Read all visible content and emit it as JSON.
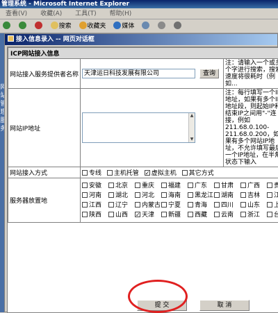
{
  "window": {
    "title": "管理系统 - Microsoft Internet Explorer",
    "menu": [
      "查看(V)",
      "收藏(A)",
      "工具(T)",
      "帮助(H)"
    ],
    "toolbar": [
      "搜索",
      "收藏夹",
      "媒体"
    ],
    "side_text": [
      "网",
      "站",
      "管",
      "理",
      "服",
      "务"
    ]
  },
  "dialog": {
    "title": "接入信息录入 -- 网页对话框",
    "section_title": "ICP网站接入信息",
    "provider": {
      "label": "网站接入服务提供者名称",
      "value": "天津运日科技发展有限公司",
      "search_button": "查询",
      "note": "注：请输入一个或多个字进行搜索，搜索速度将很耗时（例如..."
    },
    "ip": {
      "label": "网站IP地址",
      "note": "注：每行填写一个IP地址，如果有多个IP地址段，则起始IP和结束IP之间用\"-\"连接，例如211.68.0.100-211.68.0.200，如果有多个网站IP地址，不允许填写最后一个IP地址，在半角状态下输入"
    },
    "access": {
      "label": "网站接入方式",
      "options": [
        {
          "label": "专线",
          "checked": false
        },
        {
          "label": "主机托管",
          "checked": false
        },
        {
          "label": "虚拟主机",
          "checked": true
        },
        {
          "label": "其它方式",
          "checked": false
        }
      ]
    },
    "location": {
      "label": "服务器放置地",
      "provinces": [
        {
          "label": "安徽",
          "checked": false
        },
        {
          "label": "北京",
          "checked": false
        },
        {
          "label": "重庆",
          "checked": false
        },
        {
          "label": "福建",
          "checked": false
        },
        {
          "label": "广东",
          "checked": false
        },
        {
          "label": "甘肃",
          "checked": false
        },
        {
          "label": "广西",
          "checked": false
        },
        {
          "label": "贵州",
          "checked": false
        },
        {
          "label": "河南",
          "checked": false
        },
        {
          "label": "湖北",
          "checked": false
        },
        {
          "label": "河北",
          "checked": false
        },
        {
          "label": "海南",
          "checked": false
        },
        {
          "label": "黑龙江",
          "checked": false
        },
        {
          "label": "湖南",
          "checked": false
        },
        {
          "label": "吉林",
          "checked": false
        },
        {
          "label": "江苏",
          "checked": false
        },
        {
          "label": "江西",
          "checked": false
        },
        {
          "label": "辽宁",
          "checked": false
        },
        {
          "label": "内蒙古",
          "checked": false
        },
        {
          "label": "宁夏",
          "checked": false
        },
        {
          "label": "青海",
          "checked": false
        },
        {
          "label": "四川",
          "checked": false
        },
        {
          "label": "山东",
          "checked": false
        },
        {
          "label": "上海",
          "checked": false
        },
        {
          "label": "陕西",
          "checked": false
        },
        {
          "label": "山西",
          "checked": false
        },
        {
          "label": "天津",
          "checked": true
        },
        {
          "label": "新疆",
          "checked": false
        },
        {
          "label": "西藏",
          "checked": false
        },
        {
          "label": "云南",
          "checked": false
        },
        {
          "label": "浙江",
          "checked": false
        },
        {
          "label": "台湾",
          "checked": false
        }
      ]
    },
    "submit_button": "提 交",
    "cancel_button": "取 消"
  }
}
